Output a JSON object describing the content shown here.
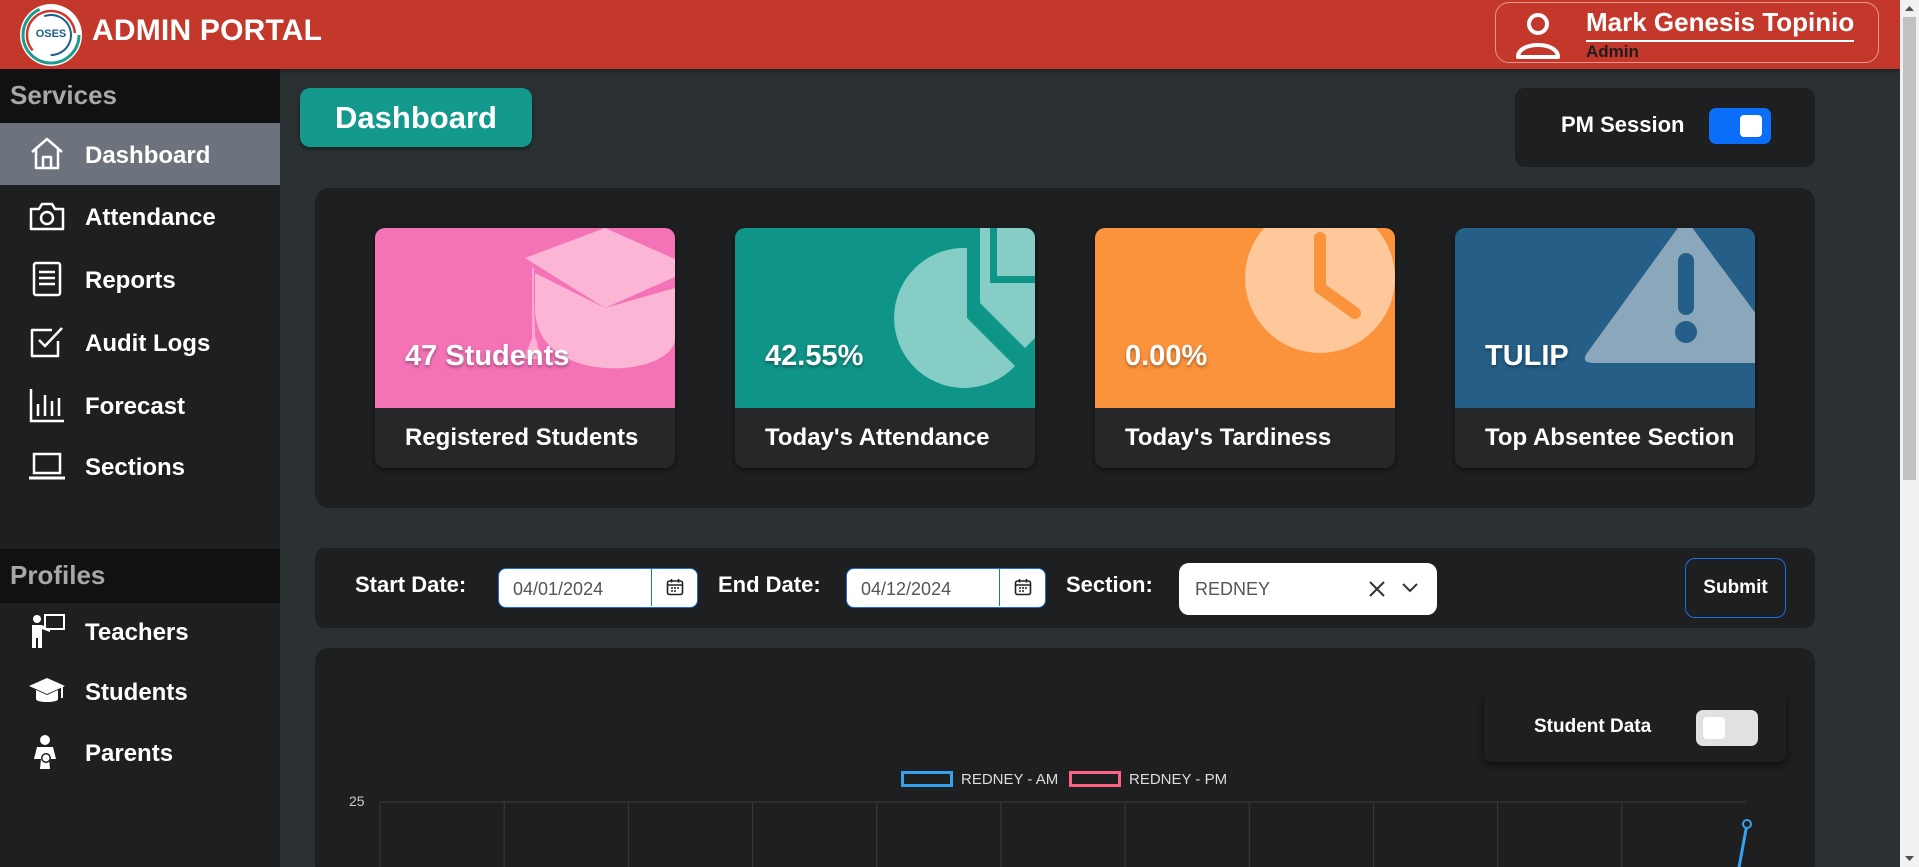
{
  "header": {
    "logo_text": "OSES",
    "title": "ADMIN PORTAL",
    "user_name": "Mark Genesis Topinio",
    "user_role": "Admin"
  },
  "sidebar": {
    "services_heading": "Services",
    "services": [
      {
        "label": "Dashboard",
        "icon": "home-icon",
        "active": true
      },
      {
        "label": "Attendance",
        "icon": "camera-icon"
      },
      {
        "label": "Reports",
        "icon": "document-icon"
      },
      {
        "label": "Audit Logs",
        "icon": "checkbox-icon"
      },
      {
        "label": "Forecast",
        "icon": "bar-chart-icon"
      },
      {
        "label": "Sections",
        "icon": "laptop-icon"
      }
    ],
    "profiles_heading": "Profiles",
    "profiles": [
      {
        "label": "Teachers",
        "icon": "teacher-icon"
      },
      {
        "label": "Students",
        "icon": "graduation-cap-icon"
      },
      {
        "label": "Parents",
        "icon": "parent-icon"
      }
    ]
  },
  "main": {
    "dashboard_label": "Dashboard",
    "pm_session_label": "PM Session",
    "pm_session_on": true
  },
  "cards": [
    {
      "value": "47 Students",
      "caption": "Registered Students",
      "color": "#f472b6",
      "icon": "graduation-cap-icon"
    },
    {
      "value": "42.55%",
      "caption": "Today's Attendance",
      "color": "#0f9488",
      "icon": "pie-chart-icon"
    },
    {
      "value": "0.00%",
      "caption": "Today's Tardiness",
      "color": "#fb923c",
      "icon": "clock-icon"
    },
    {
      "value": "TULIP",
      "caption": "Top Absentee Section",
      "color": "#255e86",
      "icon": "warning-icon"
    }
  ],
  "filters": {
    "start_label": "Start Date:",
    "start_value": "04/01/2024",
    "end_label": "End Date:",
    "end_value": "04/12/2024",
    "section_label": "Section:",
    "section_value": "REDNEY",
    "submit_label": "Submit"
  },
  "chart": {
    "student_data_label": "Student Data",
    "student_data_on": false
  },
  "chart_data": {
    "type": "line",
    "series": [
      {
        "name": "REDNEY - AM",
        "color": "#36a2eb"
      },
      {
        "name": "REDNEY - PM",
        "color": "#ff6384"
      }
    ],
    "y_ticks": [
      "25"
    ]
  }
}
